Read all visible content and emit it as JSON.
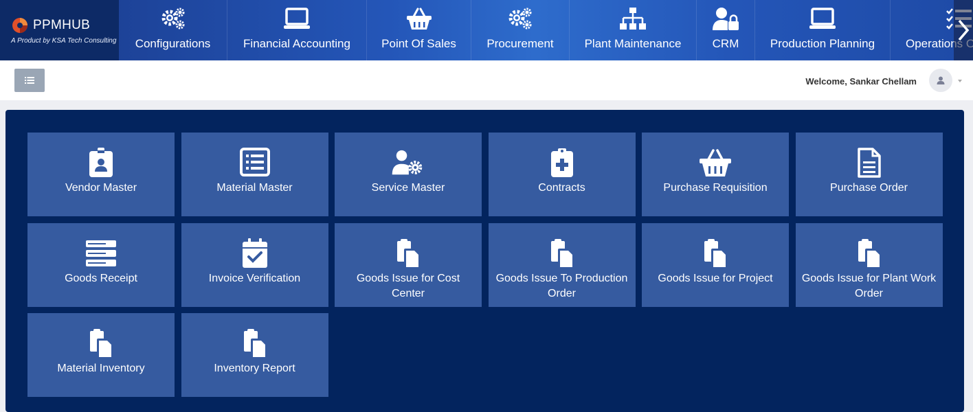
{
  "brand": {
    "name": "PPMHUB",
    "subtitle": "A Product by KSA Tech Consulting"
  },
  "nav": {
    "items": [
      {
        "label": "Configurations",
        "icon": "gears-icon"
      },
      {
        "label": "Financial Accounting",
        "icon": "laptop-icon"
      },
      {
        "label": "Point Of Sales",
        "icon": "basket-icon"
      },
      {
        "label": "Procurement",
        "icon": "gears-icon"
      },
      {
        "label": "Plant Maintenance",
        "icon": "sitemap-icon"
      },
      {
        "label": "CRM",
        "icon": "user-lock-icon"
      },
      {
        "label": "Production Planning",
        "icon": "laptop-icon"
      },
      {
        "label": "Operations O",
        "icon": "tasks-icon"
      }
    ]
  },
  "header": {
    "welcome": "Welcome, Sankar Chellam"
  },
  "tiles": [
    {
      "label": "Vendor Master",
      "icon": "id-badge-icon"
    },
    {
      "label": "Material Master",
      "icon": "list-alt-icon"
    },
    {
      "label": "Service Master",
      "icon": "user-cog-icon"
    },
    {
      "label": "Contracts",
      "icon": "clipboard-plus-icon"
    },
    {
      "label": "Purchase Requisition",
      "icon": "basket-icon"
    },
    {
      "label": "Purchase Order",
      "icon": "file-text-icon"
    },
    {
      "label": "Goods Receipt",
      "icon": "server-icon"
    },
    {
      "label": "Invoice Verification",
      "icon": "calendar-check-icon"
    },
    {
      "label": "Goods Issue for Cost Center",
      "icon": "paste-icon"
    },
    {
      "label": "Goods Issue To Production Order",
      "icon": "paste-icon"
    },
    {
      "label": "Goods Issue for Project",
      "icon": "paste-icon"
    },
    {
      "label": "Goods Issue for Plant Work Order",
      "icon": "paste-icon"
    },
    {
      "label": "Material Inventory",
      "icon": "paste-icon"
    },
    {
      "label": "Inventory Report",
      "icon": "paste-icon"
    }
  ],
  "colors": {
    "nav_bg": "#2456b8",
    "brand_bg": "#0d2a66",
    "panel_bg": "#03245e",
    "tile_bg": "#365ba0"
  }
}
